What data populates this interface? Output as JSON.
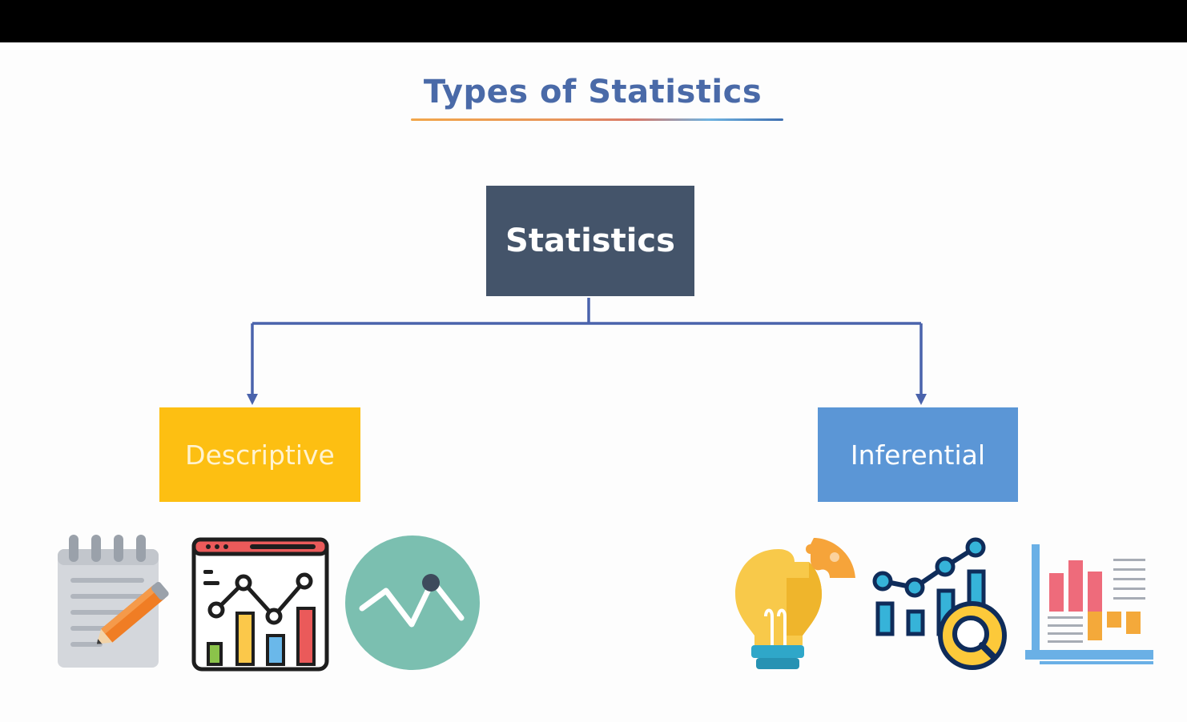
{
  "title": "Types of Statistics",
  "nodes": {
    "root": "Statistics",
    "left": "Descriptive",
    "right": "Inferential"
  },
  "colors": {
    "title": "#4a6aa8",
    "root_fill": "#44546a",
    "descriptive_fill": "#fdbf12",
    "inferential_fill": "#5b96d6",
    "connector": "#4a63ac"
  },
  "icons": {
    "descriptive": [
      "notepad-pencil-icon",
      "dashboard-chart-icon",
      "line-trend-circle-icon"
    ],
    "inferential": [
      "lightbulb-puzzle-icon",
      "chart-magnifier-icon",
      "bar-report-icon"
    ]
  }
}
